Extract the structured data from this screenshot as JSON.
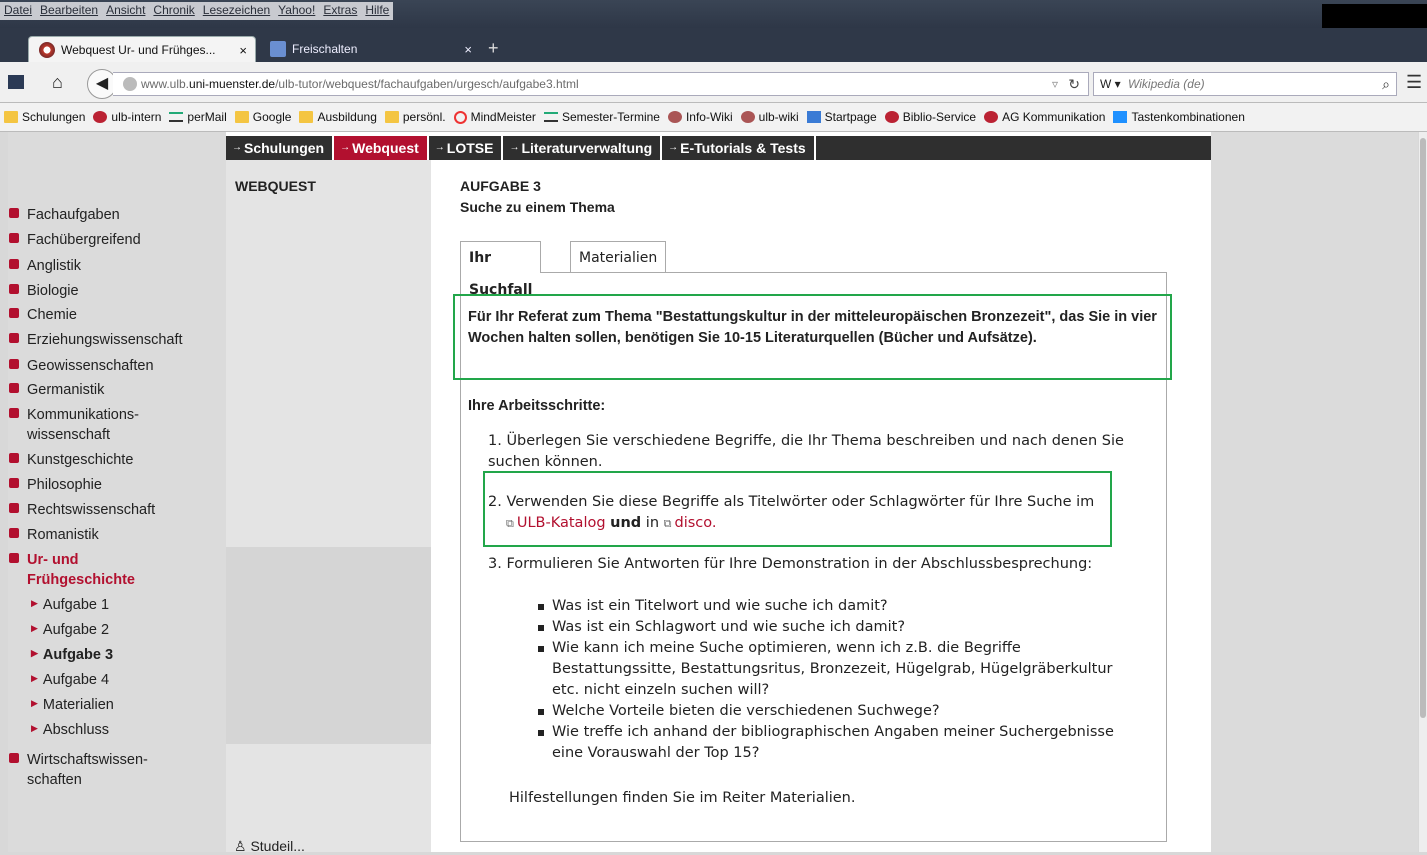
{
  "menubar": {
    "items": [
      "Datei",
      "Bearbeiten",
      "Ansicht",
      "Chronik",
      "Lesezeichen",
      "Yahoo!",
      "Extras",
      "Hilfe"
    ]
  },
  "tabs": [
    {
      "label": "Webquest Ur- und Frühges...",
      "close": "×",
      "icon": "firefox-icon"
    },
    {
      "label": "Freischalten",
      "close": "×",
      "icon": "page-icon"
    }
  ],
  "newtab": "+",
  "nav": {
    "url_prefix": "www.ulb.",
    "url_host": "uni-muenster.de",
    "url_path": "/ulb-tutor/webquest/fachaufgaben/urgesch/aufgabe3.html",
    "search_placeholder": "Wikipedia (de)",
    "search_engine": "W ▾"
  },
  "bookmarks": [
    "Schulungen",
    "ulb-intern",
    "perMail",
    "Google",
    "Ausbildung",
    "persönl.",
    "MindMeister",
    "Semester-Termine",
    "Info-Wiki",
    "ulb-wiki",
    "Startpage",
    "Biblio-Service",
    "AG Kommunikation",
    "Tastenkombinationen"
  ],
  "topnav": [
    "Schulungen",
    "Webquest",
    "LOTSE",
    "Literaturverwaltung",
    "E-Tutorials & Tests"
  ],
  "sidebar": {
    "title": "WEBQUEST",
    "items": [
      "Fachaufgaben",
      "Fachübergreifend",
      "Anglistik",
      "Biologie",
      "Chemie",
      "Erziehungswissenschaft",
      "Geowissenschaften",
      "Germanistik",
      "Kommunikations-",
      "wissenschaft",
      "Kunstgeschichte",
      "Philosophie",
      "Rechtswissenschaft",
      "Romanistik",
      "Ur- und",
      "Frühgeschichte",
      "Wirtschaftswissen-",
      "schaften"
    ],
    "subitems": [
      "Aufgabe 1",
      "Aufgabe 2",
      "Aufgabe 3",
      "Aufgabe 4",
      "Materialien",
      "Abschluss"
    ],
    "bottom": "Studeil..."
  },
  "main": {
    "aufgabe": "AUFGABE 3",
    "subtitle": "Suche zu einem Thema",
    "tabs": [
      "Ihr Suchfall",
      "Materialien"
    ],
    "intro": "Für Ihr Referat zum Thema \"Bestattungskultur in der mitteleuropäischen Bronzezeit\", das Sie in vier Wochen halten sollen, benötigen Sie 10-15 Literaturquellen (Bücher und Aufsätze).",
    "arbeit_title": "Ihre Arbeitsschritte:",
    "step1": "1. Überlegen Sie verschiedene Begriffe, die Ihr Thema beschreiben und nach denen Sie suchen können.",
    "step2_a": "2. Verwenden Sie diese Begriffe als Titelwörter oder Schlagwörter für Ihre Suche im",
    "step2_link1": "ULB-Katalog",
    "step2_und": "und",
    "step2_in": "in",
    "step2_link2": "disco",
    "step3": "3. Formulieren Sie Antworten für Ihre Demonstration in der Abschlussbesprechung:",
    "bullets": [
      "Was ist ein Titelwort und wie suche ich damit?",
      "Was ist ein Schlagwort und wie suche ich damit?",
      "Wie kann ich meine Suche optimieren, wenn ich z.B. die Begriffe Bestattungssitte, Bestattungsritus, Bronzezeit, Hügelgrab, Hügelgräberkultur etc. nicht einzeln suchen will?",
      "Welche Vorteile bieten die verschiedenen Suchwege?",
      "Wie treffe ich anhand der bibliographischen Angaben meiner Suchergebnisse eine Vorauswahl der Top 15?"
    ],
    "hilfe": "Hilfestellungen finden Sie im Reiter Materialien."
  },
  "colors": {
    "accent": "#b2102f",
    "highlight_box": "#22a64a"
  }
}
